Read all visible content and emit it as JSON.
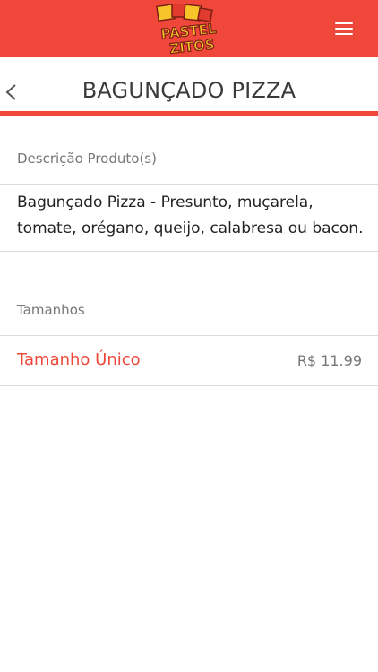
{
  "header": {
    "logo_line1": "PASTEL",
    "logo_line2": "ZITOS",
    "menu_icon": "hamburger-menu-icon",
    "background_color": "#f0473b"
  },
  "title_bar": {
    "back_icon": "chevron-left-icon",
    "title": "BAGUNÇADO PIZZA"
  },
  "description": {
    "label": "Descrição Produto(s)",
    "text": "Bagunçado Pizza - Presunto, muçarela, tomate, orégano, queijo, calabresa ou bacon."
  },
  "sizes": {
    "label": "Tamanhos",
    "items": [
      {
        "name": "Tamanho Único",
        "price": "R$ 11.99"
      }
    ]
  },
  "colors": {
    "accent": "#f0473b",
    "muted_text": "#777777"
  }
}
